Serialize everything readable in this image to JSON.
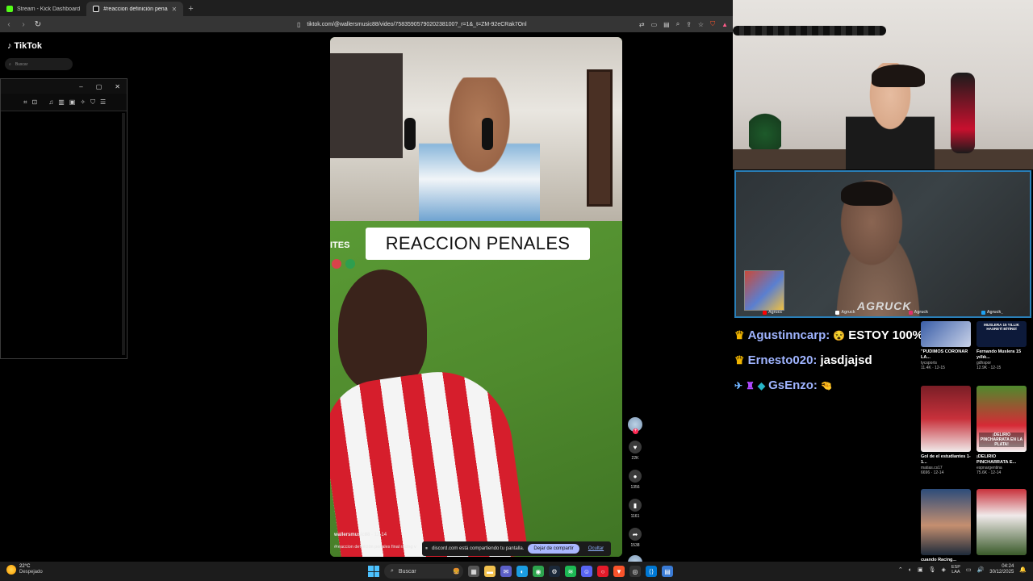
{
  "browser": {
    "tabs": [
      {
        "title": "Stream - Kick Dashboard",
        "active": false,
        "favicon_color": "#53fc18"
      },
      {
        "title": "#reaccion definición penales fin",
        "active": true,
        "favicon_color": "#ffffff"
      }
    ],
    "new_tab_symbol": "+",
    "url": "tiktok.com/@wallersmusic88/video/7583590579020238100?_r=1&_t=ZM-92eCRak7Onl"
  },
  "tiktok": {
    "logo_text": "TikTok",
    "search_placeholder": "Buscar",
    "video": {
      "caption": "REACCION PENALES",
      "scorebug_text": "ITES",
      "author": "wallersmusic88",
      "date": "12-14",
      "description": "#reaccion definición penales final racing v"
    },
    "actions": {
      "likes": "22K",
      "comments": "1356",
      "saves": "1161",
      "shares": "1538"
    }
  },
  "share_bar": {
    "message": "discord.com está compartiendo tu pantalla.",
    "stop_label": "Dejar de compartir",
    "hide_label": "Ocultar"
  },
  "stream": {
    "cam_watermark": "AGRUCK",
    "handles": [
      "Agrucc",
      "Agruck",
      "Agruck",
      "Agruck_"
    ],
    "chat": [
      {
        "user": "Agustinncarp:",
        "text": "ESTOY 100%",
        "prefix": "crown",
        "emote": "😵"
      },
      {
        "user": "Ernesto020:",
        "text": "jasdjajsd",
        "prefix": "crown",
        "emote": ""
      },
      {
        "user": "GsEnzo:",
        "text": "",
        "prefix": "badges",
        "emote": "🤏"
      }
    ]
  },
  "related": [
    {
      "title": "\"PUDIMOS CORONAR LA...",
      "author": "tycsports",
      "stats": "11.4K · 12-15",
      "overlay": ""
    },
    {
      "title": "Fernando Muslera 15 yıllık...",
      "author": "gdhspor",
      "stats": "12.9K · 12-15",
      "overlay": "MUSLERA 15 YILLIK HASRETİ BİTİRDİ"
    },
    {
      "title": "Gol de el estudiantes 1-1...",
      "author": "matias.cs17",
      "stats": "6696 · 12-14",
      "overlay": ""
    },
    {
      "title": "¡DELIRIO PINCHARRATA E...",
      "author": "espnargentina",
      "stats": "75.6K · 12-14",
      "overlay": "¡DELIRIO PINCHARRATA EN LA PLATA!"
    },
    {
      "title": "cuando Racing...",
      "author": "",
      "stats": "",
      "overlay": ""
    },
    {
      "title": "",
      "author": "",
      "stats": "",
      "overlay": ""
    }
  ],
  "taskbar": {
    "weather_temp": "22°C",
    "weather_cond": "Despejado",
    "search_placeholder": "Buscar",
    "lang_top": "ESP",
    "lang_bottom": "LAA",
    "time": "04:24",
    "date": "30/12/2025"
  }
}
